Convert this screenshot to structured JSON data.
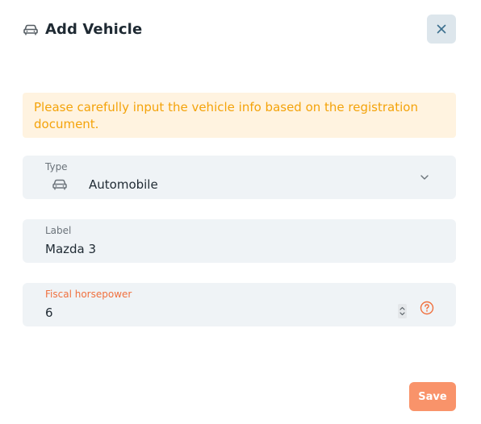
{
  "dialog": {
    "title": "Add Vehicle",
    "title_icon": "car-icon",
    "close_icon": "close-icon"
  },
  "alert": {
    "text": "Please carefully input the vehicle info based on the registration document."
  },
  "form": {
    "type": {
      "label": "Type",
      "value": "Automobile",
      "icon": "car-icon",
      "dropdown_icon": "chevron-down-icon"
    },
    "label_field": {
      "label": "Label",
      "value": "Mazda 3"
    },
    "fiscal_horsepower": {
      "label": "Fiscal horsepower",
      "value": "6",
      "help_icon": "help-circle-icon"
    }
  },
  "actions": {
    "save_label": "Save"
  },
  "colors": {
    "accent": "#f9936a",
    "warning_text": "#f4a30a",
    "warning_bg": "#fff3e0",
    "field_bg": "#eff3f6",
    "focus_label": "#f0703e"
  }
}
